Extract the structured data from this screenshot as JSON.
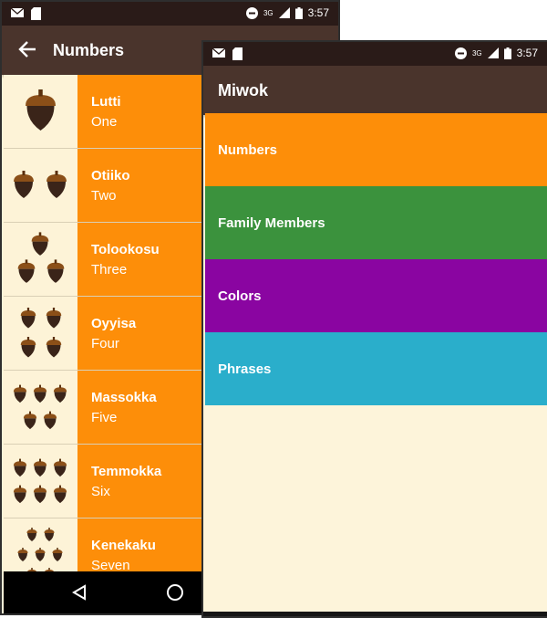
{
  "numbers_screen": {
    "status": {
      "time": "3:57",
      "network": "3G"
    },
    "toolbar": {
      "back_icon": "arrow-left-icon",
      "title": "Numbers"
    },
    "items": [
      {
        "miwok": "Lutti",
        "english": "One",
        "count": 1
      },
      {
        "miwok": "Otiiko",
        "english": "Two",
        "count": 2
      },
      {
        "miwok": "Tolookosu",
        "english": "Three",
        "count": 3
      },
      {
        "miwok": "Oyyisa",
        "english": "Four",
        "count": 4
      },
      {
        "miwok": "Massokka",
        "english": "Five",
        "count": 5
      },
      {
        "miwok": "Temmokka",
        "english": "Six",
        "count": 6
      },
      {
        "miwok": "Kenekaku",
        "english": "Seven",
        "count": 7
      }
    ],
    "colors": {
      "item_background": "#fd8e09",
      "image_background": "#fdf3d7",
      "toolbar": "#4a342c"
    }
  },
  "main_screen": {
    "status": {
      "time": "3:57",
      "network": "3G"
    },
    "toolbar": {
      "title": "Miwok"
    },
    "categories": [
      {
        "label": "Numbers",
        "color": "#fd8e09"
      },
      {
        "label": "Family Members",
        "color": "#3b923d"
      },
      {
        "label": "Colors",
        "color": "#8a05a1"
      },
      {
        "label": "Phrases",
        "color": "#2aaecb"
      }
    ]
  }
}
